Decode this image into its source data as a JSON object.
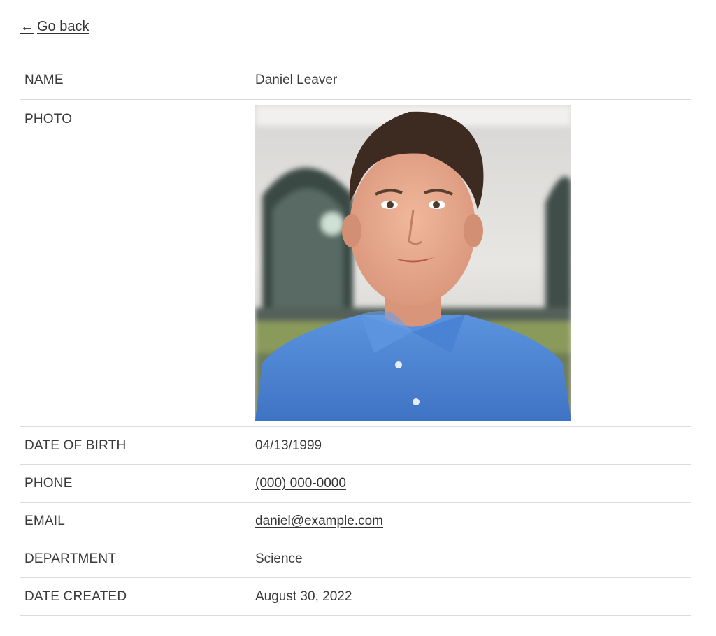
{
  "nav": {
    "back_arrow": "←",
    "back_label": "Go back"
  },
  "profile": {
    "rows": [
      {
        "label": "NAME",
        "value": "Daniel Leaver"
      },
      {
        "label": "PHOTO",
        "value": ""
      },
      {
        "label": "DATE OF BIRTH",
        "value": "04/13/1999"
      },
      {
        "label": "PHONE",
        "value": "(000) 000-0000"
      },
      {
        "label": "EMAIL",
        "value": "daniel@example.com"
      },
      {
        "label": "DEPARTMENT",
        "value": "Science"
      },
      {
        "label": "DATE CREATED",
        "value": "August 30, 2022"
      }
    ]
  },
  "colors": {
    "text": "#3a3a3a",
    "divider": "#dcdcdc",
    "shirt": "#4f86d4",
    "wall": "#e6e4e2"
  }
}
